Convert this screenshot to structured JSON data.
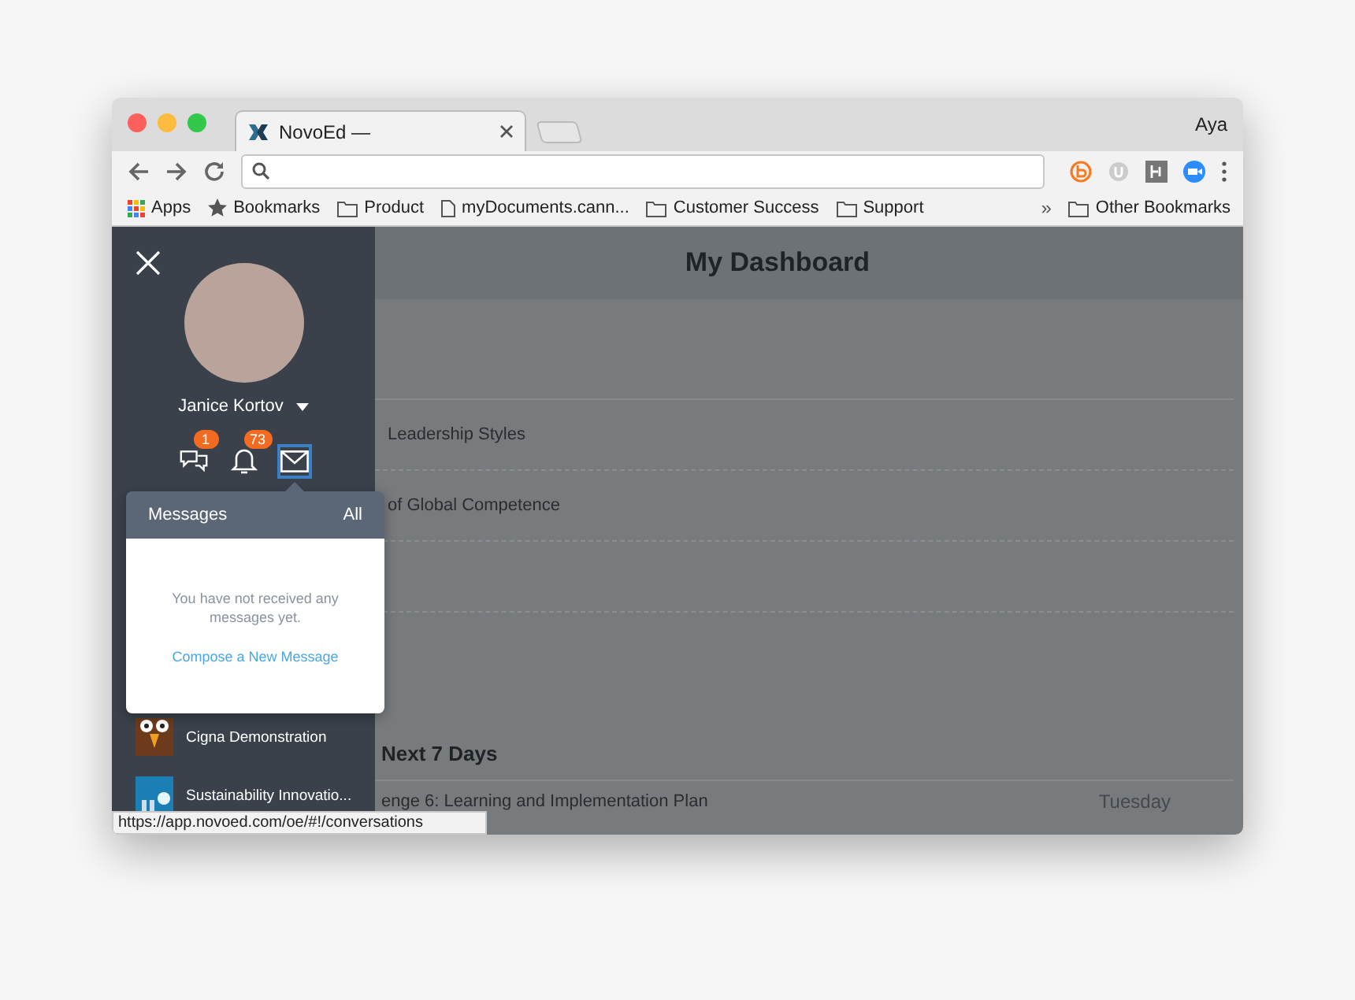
{
  "browser": {
    "tabs": [
      {
        "title": "NovoEd —",
        "selected": true
      },
      {
        "selected": false
      }
    ],
    "profile": "Aya",
    "bookmarks": [
      {
        "label": "Apps",
        "kind": "apps"
      },
      {
        "label": "Bookmarks",
        "kind": "star"
      },
      {
        "label": "Product",
        "kind": "folder"
      },
      {
        "label": "myDocuments.cann...",
        "kind": "page"
      },
      {
        "label": "Customer Success",
        "kind": "folder"
      },
      {
        "label": "Support",
        "kind": "folder"
      }
    ],
    "overflow": "»",
    "other_bookmarks": "Other Bookmarks",
    "status_url": "https://app.novoed.com/oe/#!/conversations"
  },
  "sidebar": {
    "user_name": "Janice Kortov",
    "notifications": [
      {
        "kind": "comments",
        "badge": "1",
        "selected": false
      },
      {
        "kind": "bell",
        "badge": "73",
        "selected": false
      },
      {
        "kind": "mail",
        "selected": true
      }
    ],
    "courses": [
      {
        "name": "Cigna Demonstration",
        "kind": "owl"
      },
      {
        "name": "Sustainability Innovatio...",
        "kind": "lights"
      }
    ]
  },
  "messages_popover": {
    "title": "Messages",
    "link": "All",
    "empty_text": "You have not received any messages yet.",
    "compose": "Compose a New Message"
  },
  "dashboard": {
    "title": "My Dashboard",
    "rows": [
      "Leadership Styles",
      "of Global Competence",
      ""
    ],
    "section": "Next 7 Days",
    "due": [
      {
        "title": "enge 6: Learning and Implementation Plan",
        "day": "Tuesday"
      }
    ]
  }
}
